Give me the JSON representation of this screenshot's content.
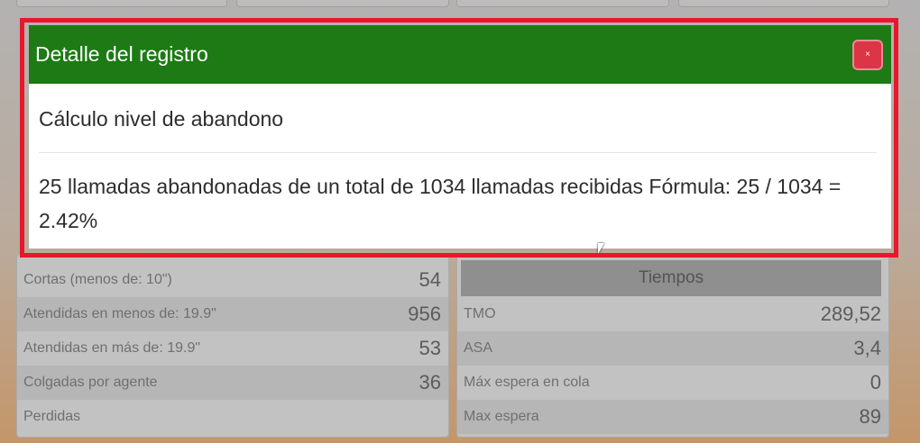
{
  "modal": {
    "title": "Detalle del registro",
    "close_label": "×",
    "subtitle": "Cálculo nivel de abandono",
    "detail": "25 llamadas abandonadas de un total de 1034 llamadas recibidas Fórmula: 25 / 1034 = 2.42%"
  },
  "left_panel": {
    "rows": [
      {
        "label": "Cortas (menos de: 10\")",
        "value": "54"
      },
      {
        "label": "Atendidas en menos de: 19.9\"",
        "value": "956"
      },
      {
        "label": "Atendidas en más de: 19.9\"",
        "value": "53"
      },
      {
        "label": "Colgadas por agente",
        "value": "36"
      },
      {
        "label": "Perdidas",
        "value": ""
      }
    ]
  },
  "right_panel": {
    "header": "Tiempos",
    "rows": [
      {
        "label": "TMO",
        "value": "289,52"
      },
      {
        "label": "ASA",
        "value": "3,4"
      },
      {
        "label": "Máx espera en cola",
        "value": "0"
      },
      {
        "label": "Max espera",
        "value": "89"
      }
    ]
  },
  "colors": {
    "modal_header": "#1d7a15",
    "highlight_border": "#e8172b",
    "close_button": "#dc3545"
  }
}
